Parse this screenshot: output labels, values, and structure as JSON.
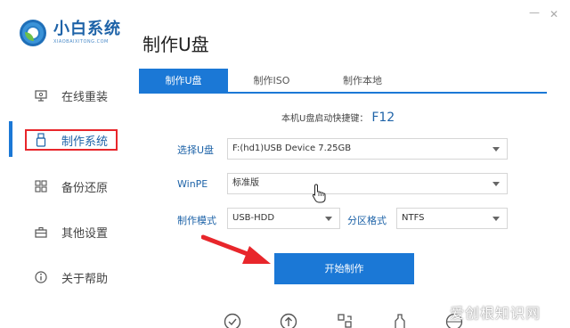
{
  "app": {
    "logo_name": "小白系统",
    "logo_sub": "XIAOBAIXITONG.COM",
    "page_title": "制作U盘",
    "window_min": "—",
    "window_close": "✕"
  },
  "sidebar": {
    "items": [
      {
        "label": "在线重装",
        "icon": "monitor-icon"
      },
      {
        "label": "制作系统",
        "icon": "usb-icon"
      },
      {
        "label": "备份还原",
        "icon": "grid-icon"
      },
      {
        "label": "其他设置",
        "icon": "briefcase-icon"
      },
      {
        "label": "关于帮助",
        "icon": "info-icon"
      }
    ],
    "active_index": 1
  },
  "tabs": [
    {
      "label": "制作U盘",
      "active": true
    },
    {
      "label": "制作ISO",
      "active": false
    },
    {
      "label": "制作本地",
      "active": false
    }
  ],
  "shortcut": {
    "label": "本机U盘启动快捷键：",
    "key": "F12"
  },
  "form": {
    "usb_label": "选择U盘",
    "usb_value": "F:(hd1)USB Device 7.25GB",
    "winpe_label": "WinPE",
    "winpe_value": "标准版",
    "mode_label": "制作模式",
    "mode_value": "USB-HDD",
    "partition_label": "分区格式",
    "partition_value": "NTFS"
  },
  "start_button": "开始制作",
  "bottom_icons": [
    "check-circle-icon",
    "upload-circle-icon",
    "swap-icon",
    "tool-icon",
    "globe-icon"
  ],
  "watermark": "爱创根知识网",
  "colors": {
    "accent": "#1b78d6",
    "brand": "#1e63a8",
    "highlight": "#e8262b"
  }
}
